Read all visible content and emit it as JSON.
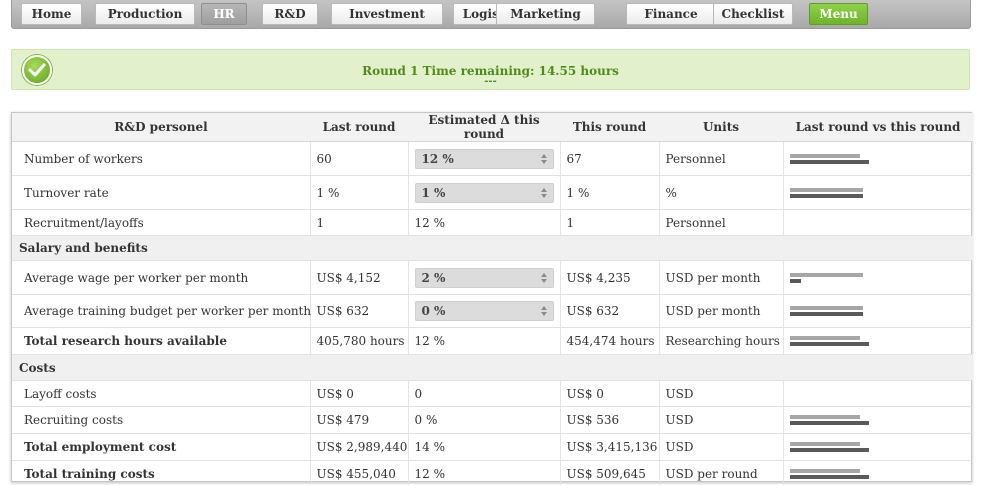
{
  "nav": [
    {
      "label": "Home",
      "state": "normal"
    },
    {
      "label": "Production",
      "state": "normal"
    },
    {
      "label": "HR",
      "state": "active"
    },
    {
      "label": "R&D",
      "state": "normal"
    },
    {
      "label": "Investment",
      "state": "normal"
    },
    {
      "label": "Logistic",
      "state": "normal"
    },
    {
      "label": "Marketing",
      "state": "normal"
    },
    {
      "label": "Finance",
      "state": "normal"
    },
    {
      "label": "Checklist",
      "state": "normal"
    },
    {
      "label": "Menu",
      "state": "menu"
    }
  ],
  "status": {
    "title": "Round 1 Time remaining: 14.55 hours",
    "sub": "---",
    "icon": "check-icon",
    "color": "#4f8a1b"
  },
  "table": {
    "headers": [
      "R&D personel",
      "Last round",
      "Estimated Δ this round",
      "This round",
      "Units",
      "Last round vs this round"
    ],
    "rows": [
      {
        "type": "row",
        "bold": false,
        "label": "Number of workers",
        "last": "60",
        "est": "12 %",
        "est_input": true,
        "this": "67",
        "units": "Personnel",
        "bar_last": 0.8,
        "bar_this": 0.893
      },
      {
        "type": "row",
        "bold": false,
        "label": "Turnover rate",
        "last": "1 %",
        "est": "1 %",
        "est_input": true,
        "this": "1 %",
        "units": "%",
        "bar_last": 0.83,
        "bar_this": 0.83
      },
      {
        "type": "row",
        "bold": false,
        "label": "Recruitment/layoffs",
        "last": "1",
        "est": "12 %",
        "est_input": false,
        "this": "1",
        "units": "Personnel",
        "bar_last": null,
        "bar_this": null
      },
      {
        "type": "section",
        "label": "Salary and benefits"
      },
      {
        "type": "row",
        "bold": false,
        "label": "Average wage per worker per month",
        "last": "US$ 4,152",
        "est": "2 %",
        "est_input": true,
        "this": "US$ 4,235",
        "units": "USD per month",
        "bar_last": 0.83,
        "bar_this": 0.13
      },
      {
        "type": "row",
        "bold": false,
        "label": "Average training budget per worker per month",
        "last": "US$ 632",
        "est": "0 %",
        "est_input": true,
        "this": "US$ 632",
        "units": "USD per month",
        "bar_last": 0.83,
        "bar_this": 0.83
      },
      {
        "type": "row",
        "bold": true,
        "label": "Total research hours available",
        "last": "405,780 hours",
        "est": "12 %",
        "est_input": false,
        "this": "454,474 hours",
        "units": "Researching hours",
        "bar_last": 0.8,
        "bar_this": 0.893
      },
      {
        "type": "section",
        "label": "Costs"
      },
      {
        "type": "row",
        "bold": false,
        "label": "Layoff costs",
        "last": "US$ 0",
        "est": "0",
        "est_input": false,
        "this": "US$ 0",
        "units": "USD",
        "bar_last": null,
        "bar_this": null
      },
      {
        "type": "row",
        "bold": false,
        "label": "Recruiting costs",
        "last": "US$ 479",
        "est": "0 %",
        "est_input": false,
        "this": "US$ 536",
        "units": "USD",
        "bar_last": 0.8,
        "bar_this": 0.893
      },
      {
        "type": "row",
        "bold": true,
        "label": "Total employment cost",
        "last": "US$ 2,989,440",
        "est": "14 %",
        "est_input": false,
        "this": "US$ 3,415,136",
        "units": "USD",
        "bar_last": 0.8,
        "bar_this": 0.893
      },
      {
        "type": "row",
        "bold": true,
        "label": "Total training costs",
        "last": "US$ 455,040",
        "est": "12 %",
        "est_input": false,
        "this": "US$ 509,645",
        "units": "USD per round",
        "bar_last": 0.8,
        "bar_this": 0.893
      }
    ]
  },
  "colors": {
    "bar_last": "#a6a6a6",
    "bar_this": "#5a5a5a",
    "menu_button": "#6db32b",
    "status_bg": "#e2f1cc"
  }
}
